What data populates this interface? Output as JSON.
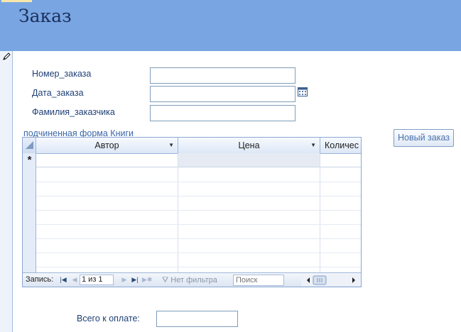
{
  "form": {
    "title": "Заказ"
  },
  "fields": [
    {
      "label": "Номер_заказа",
      "value": ""
    },
    {
      "label": "Дата_заказа",
      "value": ""
    },
    {
      "label": "Фамилия_заказчика",
      "value": ""
    }
  ],
  "subform": {
    "label": "подчиненная форма Книги",
    "columns": [
      "Автор",
      "Цена",
      "Количес"
    ],
    "new_row_marker": "*",
    "navigation": {
      "record_label": "Запись:",
      "record_counter": "1 из 1",
      "filter_label": "Нет фильтра",
      "search_placeholder": "Поиск"
    }
  },
  "buttons": {
    "new_order": "Новый заказ"
  },
  "total": {
    "label": "Всего к оплате:",
    "value": ""
  },
  "icons": {
    "edit": "pencil-icon",
    "date_picker": "calendar-icon",
    "nav_first": "first-record-icon",
    "nav_prev": "previous-record-icon",
    "nav_next": "next-record-icon",
    "nav_last": "last-record-icon",
    "nav_new": "new-record-icon",
    "filter": "filter-icon"
  },
  "colors": {
    "header_background": "#79a6e3",
    "title_text": "#1b2f5c",
    "label_text": "#1e3f75",
    "border": "#7f9db9"
  }
}
